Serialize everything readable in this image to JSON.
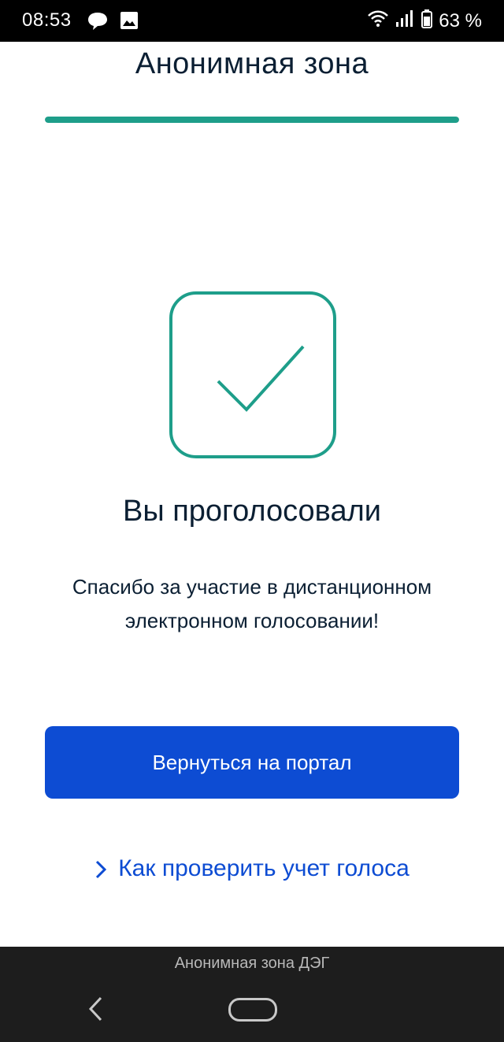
{
  "status_bar": {
    "time": "08:53",
    "battery_text": "63 %",
    "icons": [
      "chat-bubble-icon",
      "image-icon",
      "wifi-icon",
      "signal-icon",
      "battery-icon"
    ]
  },
  "header": {
    "title": "Анонимная зона",
    "progress": 1.0,
    "progress_color": "#1e9e8a"
  },
  "result": {
    "icon": "checkmark-icon",
    "icon_color": "#1e9e8a",
    "heading": "Вы проголосовали",
    "message": "Спасибо за участие в дистанционном электронном голосовании!"
  },
  "actions": {
    "primary_label": "Вернуться на портал",
    "primary_color": "#0d4cd3",
    "help_link_label": "Как проверить учет голоса",
    "link_color": "#0d4cd3"
  },
  "nav_bar": {
    "app_title": "Анонимная зона ДЭГ"
  }
}
